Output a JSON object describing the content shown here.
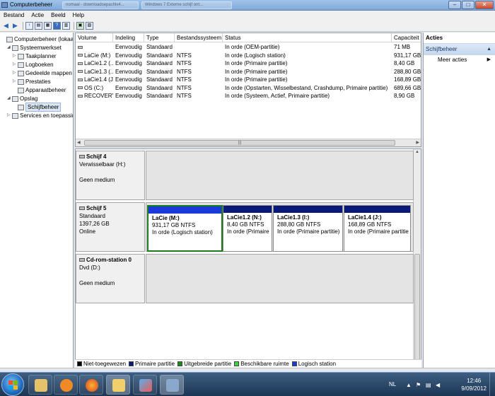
{
  "window": {
    "title": "Computerbeheer",
    "ghost_tabs": [
      "nomaal - downloadsepachlx4...",
      "Windows 7 Externe schijf ont..."
    ],
    "min_label": "–",
    "max_label": "□",
    "close_label": "✕"
  },
  "menu": [
    "Bestand",
    "Actie",
    "Beeld",
    "Help"
  ],
  "toolbar_icons": [
    "back-icon",
    "forward-icon",
    "up-icon",
    "console-tree-icon",
    "properties-icon",
    "help-icon",
    "export-icon",
    "show-hide-icon",
    "settings-icon"
  ],
  "tree": [
    {
      "label": "Computerbeheer (lokaal)",
      "indent": 0,
      "twisty": "",
      "icon": "computer-icon"
    },
    {
      "label": "Systeemwerkset",
      "indent": 1,
      "twisty": "◢",
      "icon": "tools-icon"
    },
    {
      "label": "Taakplanner",
      "indent": 2,
      "twisty": "▷",
      "icon": "clock-icon"
    },
    {
      "label": "Logboeken",
      "indent": 2,
      "twisty": "▷",
      "icon": "log-icon"
    },
    {
      "label": "Gedeelde mappen",
      "indent": 2,
      "twisty": "▷",
      "icon": "folder-icon"
    },
    {
      "label": "Prestaties",
      "indent": 2,
      "twisty": "▷",
      "icon": "performance-icon"
    },
    {
      "label": "Apparaatbeheer",
      "indent": 2,
      "twisty": "",
      "icon": "device-icon"
    },
    {
      "label": "Opslag",
      "indent": 1,
      "twisty": "◢",
      "icon": "storage-icon"
    },
    {
      "label": "Schijfbeheer",
      "indent": 2,
      "twisty": "",
      "icon": "disk-icon",
      "selected": true
    },
    {
      "label": "Services en toepassingen",
      "indent": 1,
      "twisty": "▷",
      "icon": "services-icon"
    }
  ],
  "volumes": {
    "columns": [
      "Volume",
      "Indeling",
      "Type",
      "Bestandssysteem",
      "Status",
      "Capaciteit"
    ],
    "rows": [
      [
        "",
        "Eenvoudig",
        "Standaard",
        "",
        "In orde (OEM-partitie)",
        "71 MB"
      ],
      [
        "LaCie (M:)",
        "Eenvoudig",
        "Standaard",
        "NTFS",
        "In orde (Logisch station)",
        "931,17 GB"
      ],
      [
        "LaCie1.2 (...",
        "Eenvoudig",
        "Standaard",
        "NTFS",
        "In orde (Primaire partitie)",
        "8,40 GB"
      ],
      [
        "LaCie1.3 (...",
        "Eenvoudig",
        "Standaard",
        "NTFS",
        "In orde (Primaire partitie)",
        "288,80 GB"
      ],
      [
        "LaCie1.4 (J...",
        "Eenvoudig",
        "Standaard",
        "NTFS",
        "In orde (Primaire partitie)",
        "168,89 GB"
      ],
      [
        "OS (C:)",
        "Eenvoudig",
        "Standaard",
        "NTFS",
        "In orde (Opstarten, Wisselbestand, Crashdump, Primaire partitie)",
        "689,66 GB"
      ],
      [
        "RECOVERY",
        "Eenvoudig",
        "Standaard",
        "NTFS",
        "In orde (Systeem, Actief, Primaire partitie)",
        "8,90 GB"
      ]
    ]
  },
  "disks": [
    {
      "name": "Schijf 4",
      "line1": "Verwisselbaar (H:)",
      "line2": "",
      "line3": "Geen medium",
      "partitions": []
    },
    {
      "name": "Schijf 5",
      "line1": "Standaard",
      "line2": "1397,26 GB",
      "line3": "Online",
      "partitions": [
        {
          "name": "LaCie  (M:)",
          "size": "931,17 GB NTFS",
          "status": "In orde (Logisch station)",
          "kind": "logical",
          "selected": true
        },
        {
          "name": "LaCie1.2  (N:)",
          "size": "8,40 GB NTFS",
          "status": "In orde (Primaire",
          "kind": "primary"
        },
        {
          "name": "LaCie1.3  (I:)",
          "size": "288,80 GB NTFS",
          "status": "In orde (Primaire partitie)",
          "kind": "primary"
        },
        {
          "name": "LaCie1.4  (J:)",
          "size": "168,89 GB NTFS",
          "status": "In orde (Primaire partitie",
          "kind": "primary"
        }
      ]
    },
    {
      "name": "Cd-rom-station 0",
      "line1": "Dvd (D:)",
      "line2": "",
      "line3": "Geen medium",
      "partitions": []
    }
  ],
  "legend": [
    {
      "label": "Niet-toegewezen",
      "color": "#000000"
    },
    {
      "label": "Primaire partitie",
      "color": "#0a1a7a"
    },
    {
      "label": "Uitgebreide partitie",
      "color": "#1b8a1b"
    },
    {
      "label": "Beschikbare ruimte",
      "color": "#3ad43a"
    },
    {
      "label": "Logisch station",
      "color": "#1a3adc"
    }
  ],
  "actions": {
    "header": "Acties",
    "section": "Schijfbeheer",
    "item": "Meer acties"
  },
  "taskbar": {
    "apps": [
      "start-button",
      "explorer-icon",
      "media-player-icon",
      "firefox-icon",
      "folder-icon",
      "paint-icon",
      "computer-management-icon"
    ],
    "lang": "NL",
    "time": "12:46",
    "date": "9/09/2012"
  }
}
